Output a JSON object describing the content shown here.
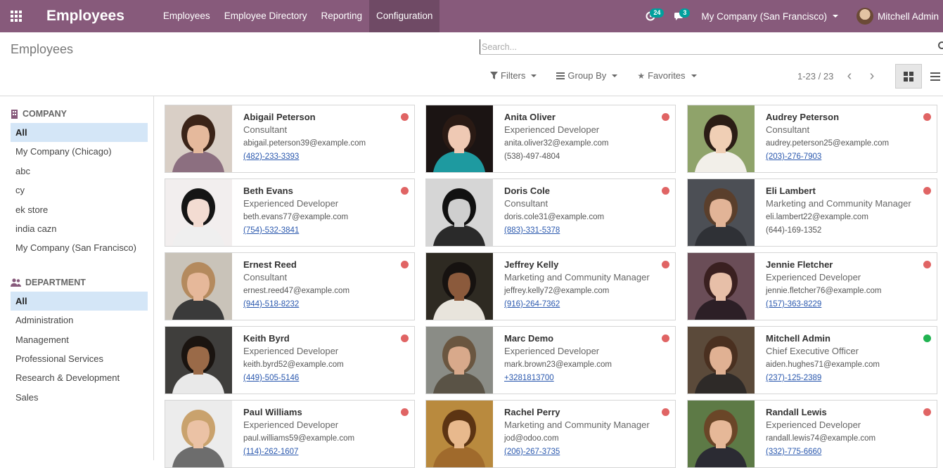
{
  "navbar": {
    "app_title": "Employees",
    "menu": [
      "Employees",
      "Employee Directory",
      "Reporting",
      "Configuration"
    ],
    "active_menu": "Configuration",
    "activity_count": "24",
    "message_count": "3",
    "company": "My Company (San Francisco)",
    "user": "Mitchell Admin"
  },
  "control_panel": {
    "title": "Employees",
    "search_placeholder": "Search...",
    "filters_label": "Filters",
    "groupby_label": "Group By",
    "favorites_label": "Favorites",
    "pager": "1-23 / 23"
  },
  "sidebar": {
    "company_header": "COMPANY",
    "companies": [
      "All",
      "My Company (Chicago)",
      "abc",
      "cy",
      "ek store",
      "india cazn",
      "My Company (San Francisco)"
    ],
    "department_header": "DEPARTMENT",
    "departments": [
      "All",
      "Administration",
      "Management",
      "Professional Services",
      "Research & Development",
      "Sales"
    ]
  },
  "status_colors": {
    "absent": "#e06464",
    "present": "#21b351"
  },
  "employees": [
    {
      "name": "Abigail Peterson",
      "job": "Consultant",
      "email": "abigail.peterson39@example.com",
      "phone": "(482)-233-3393",
      "phone_link": true,
      "status": "absent",
      "photo": {
        "bg": "#d9cfc6",
        "hair": "#3b2418",
        "skin": "#e5b99c",
        "shirt": "#8c6f80"
      }
    },
    {
      "name": "Anita Oliver",
      "job": "Experienced Developer",
      "email": "anita.oliver32@example.com",
      "phone": "(538)-497-4804",
      "phone_link": false,
      "status": "absent",
      "photo": {
        "bg": "#1b1413",
        "hair": "#2a1a14",
        "skin": "#efc9b4",
        "shirt": "#1e9aa0"
      }
    },
    {
      "name": "Audrey Peterson",
      "job": "Consultant",
      "email": "audrey.peterson25@example.com",
      "phone": "(203)-276-7903",
      "phone_link": true,
      "status": "absent",
      "photo": {
        "bg": "#8fa36a",
        "hair": "#2b1d15",
        "skin": "#f0cfb5",
        "shirt": "#f2efe9"
      }
    },
    {
      "name": "Beth Evans",
      "job": "Experienced Developer",
      "email": "beth.evans77@example.com",
      "phone": "(754)-532-3841",
      "phone_link": true,
      "status": "absent",
      "photo": {
        "bg": "#f2eeee",
        "hair": "#151515",
        "skin": "#f3dcd2",
        "shirt": "#efefef"
      }
    },
    {
      "name": "Doris Cole",
      "job": "Consultant",
      "email": "doris.cole31@example.com",
      "phone": "(883)-331-5378",
      "phone_link": true,
      "status": "absent",
      "photo": {
        "bg": "#d6d6d6",
        "hair": "#111111",
        "skin": "#cfcfcf",
        "shirt": "#2a2a2a"
      }
    },
    {
      "name": "Eli Lambert",
      "job": "Marketing and Community Manager",
      "email": "eli.lambert22@example.com",
      "phone": "(644)-169-1352",
      "phone_link": false,
      "status": "absent",
      "photo": {
        "bg": "#4c4f55",
        "hair": "#5a3f2c",
        "skin": "#e2b497",
        "shirt": "#2f3136"
      }
    },
    {
      "name": "Ernest Reed",
      "job": "Consultant",
      "email": "ernest.reed47@example.com",
      "phone": "(944)-518-8232",
      "phone_link": true,
      "status": "absent",
      "photo": {
        "bg": "#c9c3b9",
        "hair": "#b48a5e",
        "skin": "#e6b89a",
        "shirt": "#3a3a3a"
      }
    },
    {
      "name": "Jeffrey Kelly",
      "job": "Marketing and Community Manager",
      "email": "jeffrey.kelly72@example.com",
      "phone": "(916)-264-7362",
      "phone_link": true,
      "status": "absent",
      "photo": {
        "bg": "#2e2a22",
        "hair": "#161210",
        "skin": "#8b5a3c",
        "shirt": "#e8e4dc"
      }
    },
    {
      "name": "Jennie Fletcher",
      "job": "Experienced Developer",
      "email": "jennie.fletcher76@example.com",
      "phone": "(157)-363-8229",
      "phone_link": true,
      "status": "absent",
      "photo": {
        "bg": "#6a4d57",
        "hair": "#3a2020",
        "skin": "#e7bfa8",
        "shirt": "#2c1f26"
      }
    },
    {
      "name": "Keith Byrd",
      "job": "Experienced Developer",
      "email": "keith.byrd52@example.com",
      "phone": "(449)-505-5146",
      "phone_link": true,
      "status": "absent",
      "photo": {
        "bg": "#3f3e3c",
        "hair": "#1a1410",
        "skin": "#9a6a48",
        "shirt": "#e9e9e9"
      }
    },
    {
      "name": "Marc Demo",
      "job": "Experienced Developer",
      "email": "mark.brown23@example.com",
      "phone": "+3281813700",
      "phone_link": true,
      "status": "absent",
      "photo": {
        "bg": "#8a8c86",
        "hair": "#6a5640",
        "skin": "#d8a98b",
        "shirt": "#5a5346"
      }
    },
    {
      "name": "Mitchell Admin",
      "job": "Chief Executive Officer",
      "email": "aiden.hughes71@example.com",
      "phone": "(237)-125-2389",
      "phone_link": true,
      "status": "present",
      "photo": {
        "bg": "#5b4a3a",
        "hair": "#4a3020",
        "skin": "#e0b193",
        "shirt": "#2e2a28"
      }
    },
    {
      "name": "Paul Williams",
      "job": "Experienced Developer",
      "email": "paul.williams59@example.com",
      "phone": "(114)-262-1607",
      "phone_link": true,
      "status": "absent",
      "photo": {
        "bg": "#ececec",
        "hair": "#c9a26d",
        "skin": "#ebc2a5",
        "shirt": "#6d6d6d"
      }
    },
    {
      "name": "Rachel Perry",
      "job": "Marketing and Community Manager",
      "email": "jod@odoo.com",
      "phone": "(206)-267-3735",
      "phone_link": true,
      "status": "absent",
      "photo": {
        "bg": "#b98a3e",
        "hair": "#5c3413",
        "skin": "#e8b98d",
        "shirt": "#a06a2c"
      }
    },
    {
      "name": "Randall Lewis",
      "job": "Experienced Developer",
      "email": "randall.lewis74@example.com",
      "phone": "(332)-775-6660",
      "phone_link": true,
      "status": "absent",
      "photo": {
        "bg": "#5d7a46",
        "hair": "#6a4628",
        "skin": "#e6b898",
        "shirt": "#2b2b33"
      }
    }
  ]
}
